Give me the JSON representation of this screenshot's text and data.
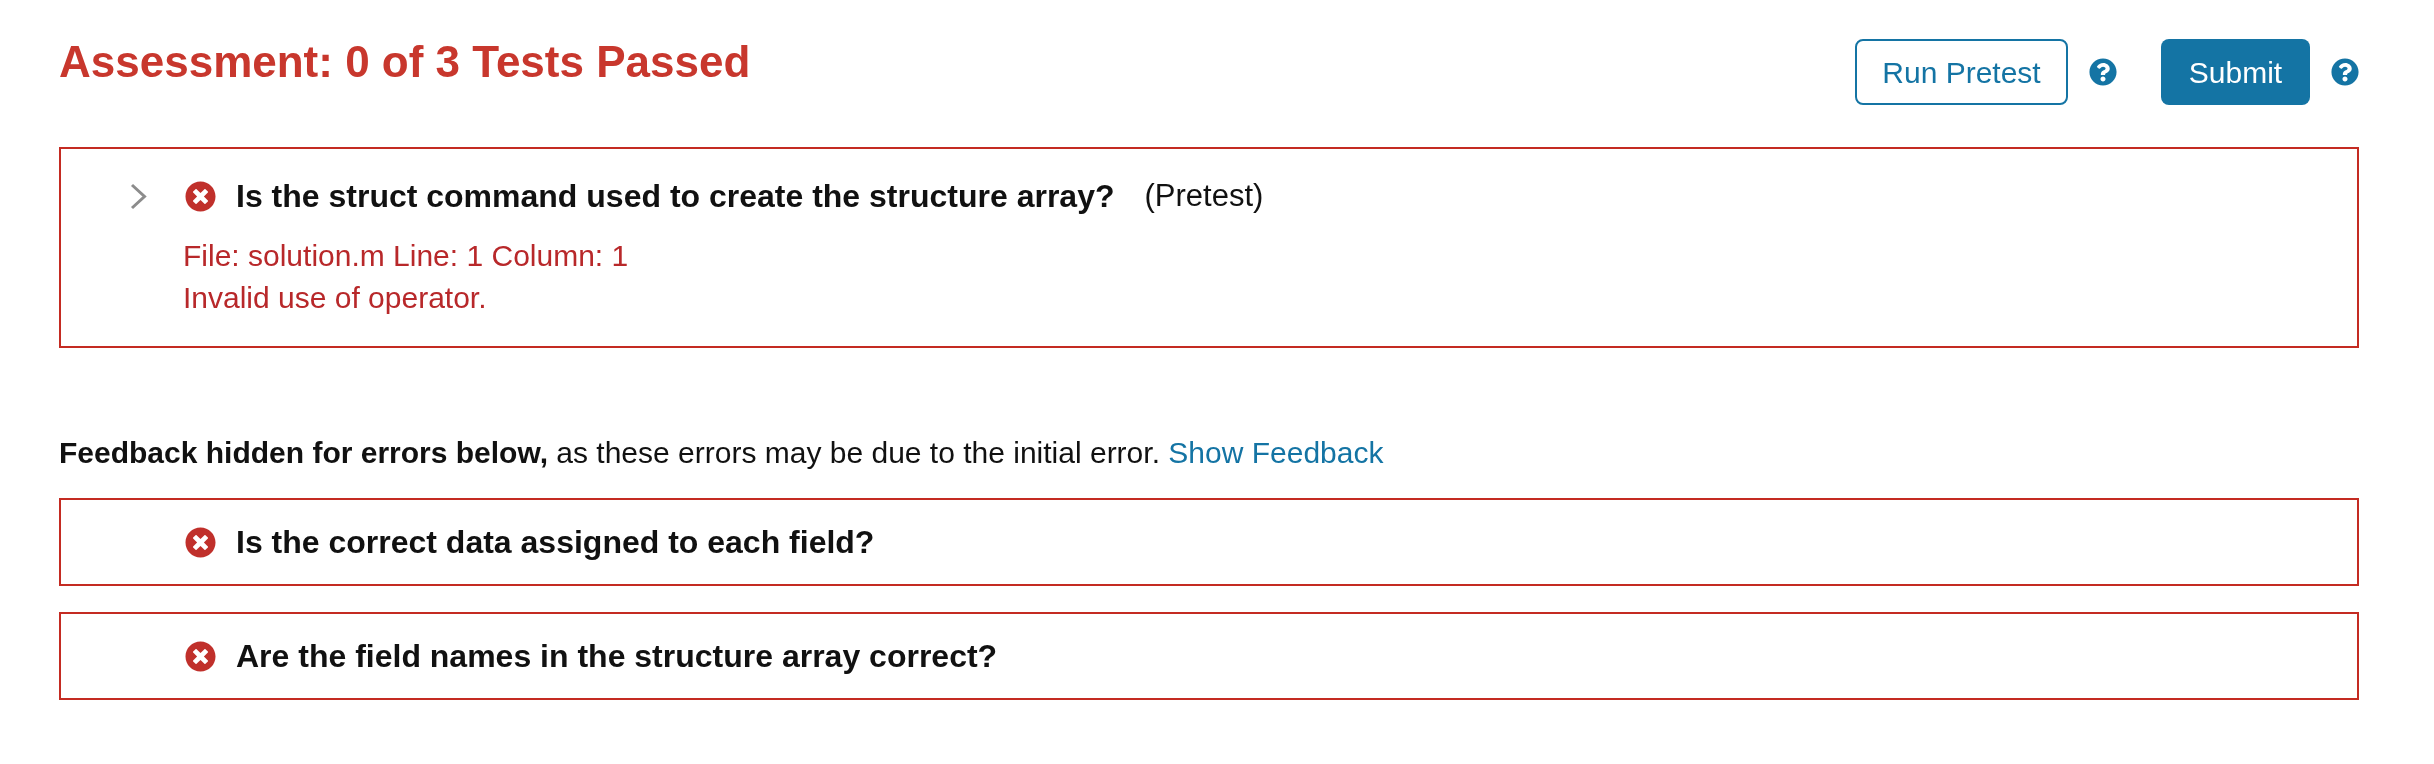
{
  "header": {
    "title": "Assessment: 0 of 3 Tests Passed",
    "actions": [
      {
        "label": "Run Pretest",
        "kind": "outline",
        "help": true
      },
      {
        "label": "Submit",
        "kind": "primary",
        "help": true
      }
    ]
  },
  "results": [
    {
      "title": "Is the struct command used to create the structure array?",
      "note": "(Pretest)",
      "passed": false,
      "collapsible": true,
      "messages": [
        "File: solution.m Line: 1 Column: 1",
        "Invalid use of operator."
      ]
    }
  ],
  "feedback_notice": {
    "text": "**Feedback hidden for errors below,** as these errors may be due to the initial error.",
    "link": "Show Feedback"
  },
  "hidden_results": [
    {
      "title": "Is the correct data assigned to each field?",
      "passed": false,
      "collapsible": false
    },
    {
      "title": "Are the field names in the structure array correct?",
      "passed": false,
      "collapsible": false
    }
  ]
}
